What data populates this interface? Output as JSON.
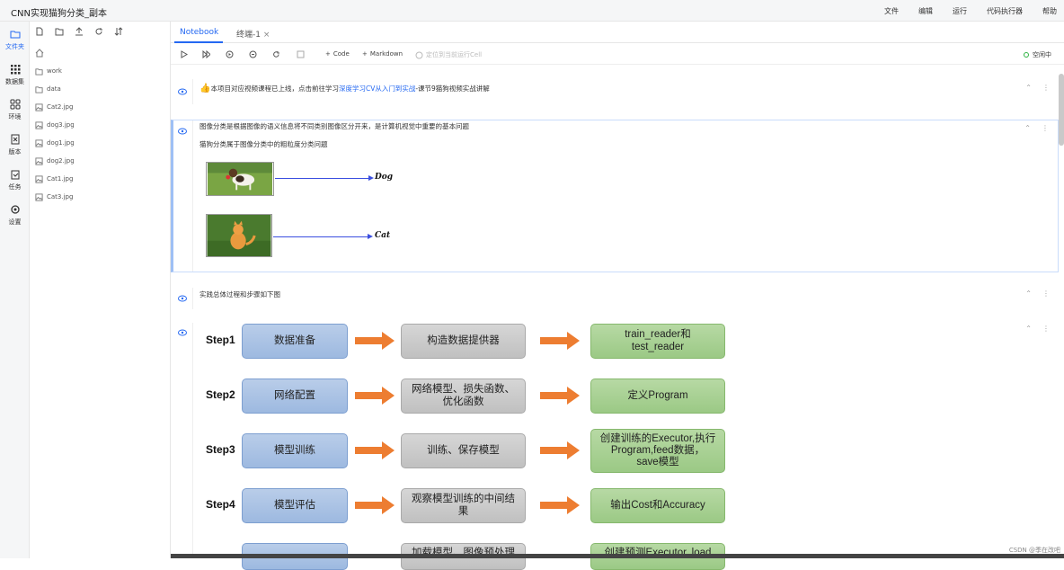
{
  "app": {
    "title": "CNN实现猫狗分类_副本"
  },
  "menu": [
    "文件",
    "编辑",
    "运行",
    "代码执行器",
    "帮助"
  ],
  "leftnav": [
    {
      "label": "文件夹",
      "icon": "folder-icon",
      "active": true
    },
    {
      "label": "数据集",
      "icon": "grid-icon"
    },
    {
      "label": "环境",
      "icon": "apps-icon"
    },
    {
      "label": "版本",
      "icon": "version-icon"
    },
    {
      "label": "任务",
      "icon": "task-icon"
    },
    {
      "label": "设置",
      "icon": "gear-icon"
    }
  ],
  "files": [
    {
      "name": "work",
      "type": "folder"
    },
    {
      "name": "data",
      "type": "folder"
    },
    {
      "name": "Cat2.jpg",
      "type": "image"
    },
    {
      "name": "dog3.jpg",
      "type": "image"
    },
    {
      "name": "dog1.jpg",
      "type": "image"
    },
    {
      "name": "dog2.jpg",
      "type": "image"
    },
    {
      "name": "Cat1.jpg",
      "type": "image"
    },
    {
      "name": "Cat3.jpg",
      "type": "image"
    }
  ],
  "tabs": [
    {
      "label": "Notebook",
      "active": true
    },
    {
      "label": "终端-1",
      "active": false
    }
  ],
  "toolbar": {
    "code_label": "Code",
    "markdown_label": "Markdown",
    "locate_label": "定位到当前运行Cell",
    "kernel_status": "空闲中"
  },
  "cells": {
    "c1": {
      "prefix": "本项目对应视频课程已上线，点击前往学习",
      "link": "深度学习CV从入门到实战",
      "suffix": "-课节9猫狗视频实战讲解"
    },
    "c2": {
      "line1": "图像分类是根据图像的语义信息将不同类别图像区分开来，是计算机视觉中重要的基本问题",
      "line2": "猫狗分类属于图像分类中的粗粒度分类问题",
      "dog_label": "Dog",
      "cat_label": "Cat"
    },
    "c3": {
      "text": "实践总体过程和步骤如下图"
    }
  },
  "steps": [
    {
      "step": "Step1",
      "a": "数据准备",
      "b": "构造数据提供器",
      "c": "train_reader和\ntest_reader"
    },
    {
      "step": "Step2",
      "a": "网络配置",
      "b": "网络模型、损失函数、\n优化函数",
      "c": "定义Program"
    },
    {
      "step": "Step3",
      "a": "模型训练",
      "b": "训练、保存模型",
      "c": "创建训练的Executor,执行\nProgram,feed数据，\nsave模型"
    },
    {
      "step": "Step4",
      "a": "模型评估",
      "b": "观察模型训练的中间结\n果",
      "c": "输出Cost和Accuracy"
    },
    {
      "step": "",
      "a": "",
      "b": "加载模型、图像预处理",
      "c": "创建预测Executor, load"
    }
  ],
  "watermark": "CSDN @季在改吧",
  "colors": {
    "accent": "#2468f2",
    "orange": "#ed7d31"
  }
}
